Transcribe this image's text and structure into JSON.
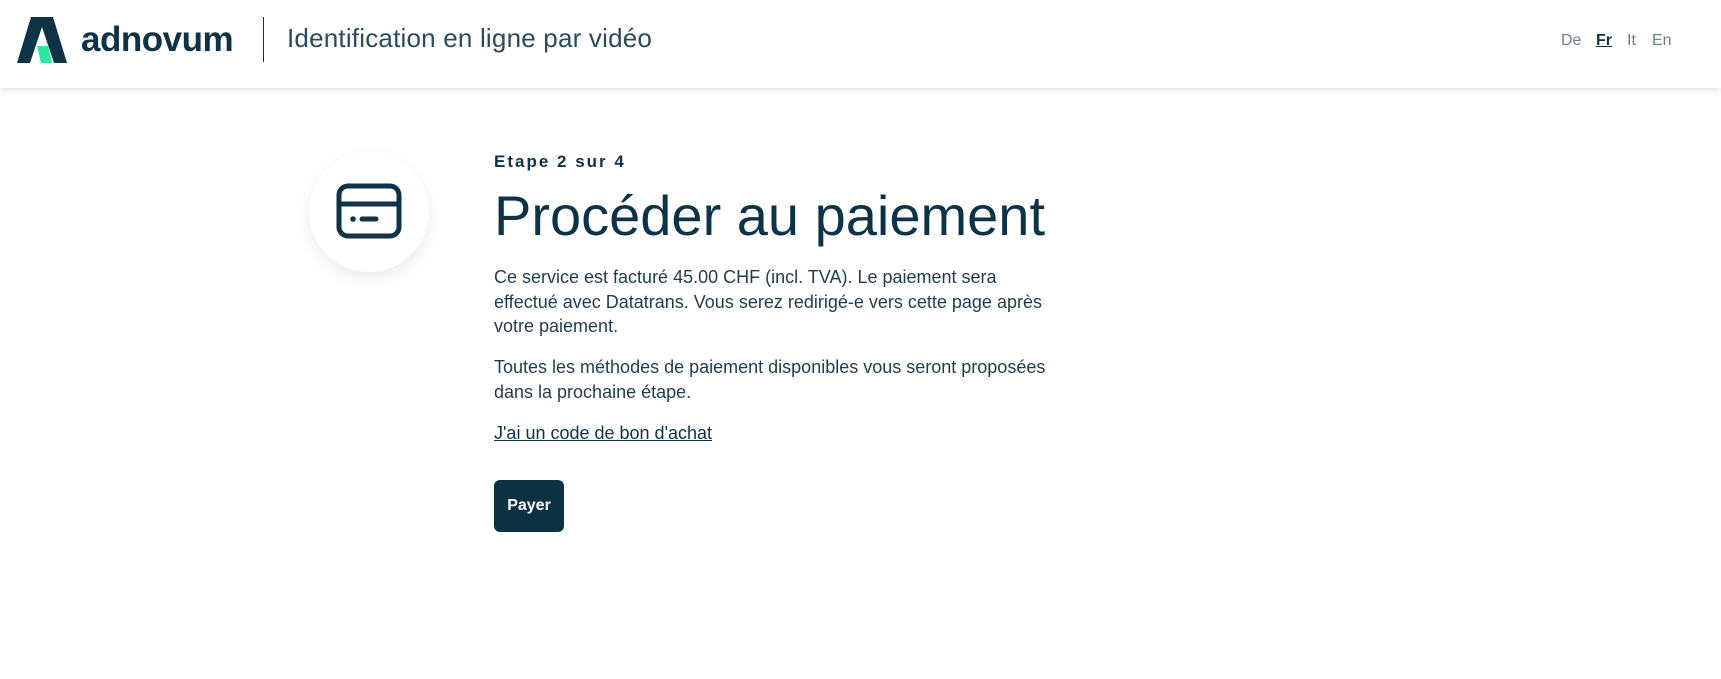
{
  "header": {
    "brand": "adnovum",
    "title": "Identification en ligne par vidéo",
    "logo_icon": "adnovum-logo-icon",
    "languages": [
      {
        "label": "De",
        "active": false
      },
      {
        "label": "Fr",
        "active": true
      },
      {
        "label": "It",
        "active": false
      },
      {
        "label": "En",
        "active": false
      }
    ]
  },
  "main": {
    "icon": "credit-card-icon",
    "step": "Etape 2 sur 4",
    "title": "Procéder au paiement",
    "paragraph1": "Ce service est facturé 45.00 CHF (incl. TVA). Le paiement sera effectué avec Datatrans. Vous serez redirigé-e vers cette page après votre paiement.",
    "paragraph2": "Toutes les méthodes de paiement disponibles vous seront proposées dans la prochaine étape.",
    "voucher_link": "J'ai un code de bon d'achat",
    "pay_button": "Payer"
  },
  "colors": {
    "primary": "#0b3142",
    "accent_green": "#2ee6a0",
    "text": "#1f3d4e",
    "muted": "#6f7f89"
  }
}
